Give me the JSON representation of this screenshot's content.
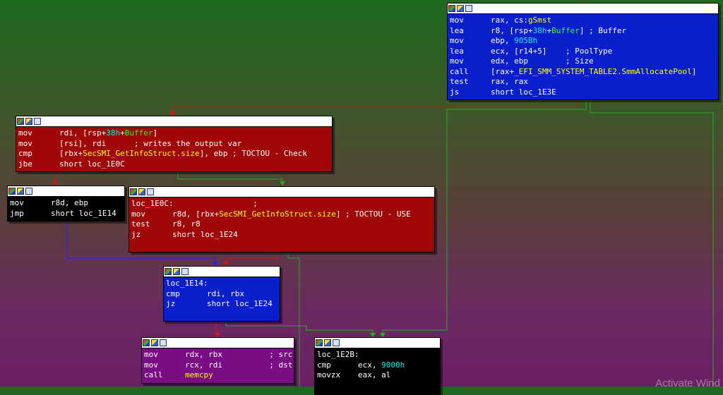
{
  "colors": {
    "blue_block": "#0a1fcc",
    "red_block": "#a00808",
    "black_block": "#000000",
    "purple_block": "#7a0c84",
    "edge_red": "#e01010",
    "edge_green": "#20b020",
    "edge_blue": "#2020ff"
  },
  "icons": [
    "graph-icon",
    "edit-icon",
    "window-icon"
  ],
  "blocks": [
    {
      "id": "block-smmalloc",
      "lines": [
        {
          "op": "mov",
          "args": [
            {
              "t": "rax, cs:"
            },
            {
              "t": "gSmst",
              "c": "y"
            }
          ]
        },
        {
          "op": "lea",
          "args": [
            {
              "t": "r8, [rsp+"
            },
            {
              "t": "38h",
              "c": "c"
            },
            {
              "t": "+"
            },
            {
              "t": "Buffer",
              "c": "g"
            },
            {
              "t": "] ; Buffer"
            }
          ]
        },
        {
          "op": "mov",
          "args": [
            {
              "t": "ebp, "
            },
            {
              "t": "905Bh",
              "c": "c"
            }
          ]
        },
        {
          "op": "lea",
          "args": [
            {
              "t": "ecx, [r14+5]    ; PoolType"
            }
          ]
        },
        {
          "op": "mov",
          "args": [
            {
              "t": "edx, ebp        ; Size"
            }
          ]
        },
        {
          "op": "call",
          "args": [
            {
              "t": "[rax+"
            },
            {
              "t": "_EFI_SMM_SYSTEM_TABLE2.SmmAllocatePool",
              "c": "y"
            },
            {
              "t": "]"
            }
          ]
        },
        {
          "op": "test",
          "args": [
            {
              "t": "rax, rax"
            }
          ]
        },
        {
          "op": "js",
          "args": [
            {
              "t": "short loc_1E3E"
            }
          ]
        }
      ]
    },
    {
      "id": "block-toctou-check",
      "lines": [
        {
          "op": "mov",
          "args": [
            {
              "t": "rdi, [rsp+"
            },
            {
              "t": "38h",
              "c": "c"
            },
            {
              "t": "+"
            },
            {
              "t": "Buffer",
              "c": "g"
            },
            {
              "t": "]"
            }
          ]
        },
        {
          "op": "mov",
          "args": [
            {
              "t": "[rsi], rdi      ; writes the output var"
            }
          ]
        },
        {
          "op": "cmp",
          "args": [
            {
              "t": "[rbx+"
            },
            {
              "t": "SecSMI_GetInfoStruct.size",
              "c": "y"
            },
            {
              "t": "], ebp ; TOCTOU - Check"
            }
          ]
        },
        {
          "op": "jbe",
          "args": [
            {
              "t": "short loc_1E0C"
            }
          ]
        }
      ]
    },
    {
      "id": "block-small-mov",
      "lines": [
        {
          "op": "mov",
          "args": [
            {
              "t": "r8d, ebp"
            }
          ]
        },
        {
          "op": "jmp",
          "args": [
            {
              "t": "short loc_1E14"
            }
          ]
        }
      ]
    },
    {
      "id": "block-toctou-use",
      "lines": [
        {
          "op": "",
          "args": [
            {
              "t": ""
            }
          ]
        },
        {
          "op": "loc_1E0C:",
          "args": [
            {
              "t": "                 ;"
            }
          ]
        },
        {
          "op": "mov",
          "args": [
            {
              "t": "r8d, [rbx+"
            },
            {
              "t": "SecSMI_GetInfoStruct.size",
              "c": "y"
            },
            {
              "t": "] ; TOCTOU - USE"
            }
          ]
        },
        {
          "op": "test",
          "args": [
            {
              "t": "r8, r8"
            }
          ]
        },
        {
          "op": "jz",
          "args": [
            {
              "t": "short loc_1E24"
            }
          ]
        }
      ]
    },
    {
      "id": "block-loc-1e14",
      "lines": [
        {
          "op": "",
          "args": [
            {
              "t": ""
            }
          ]
        },
        {
          "op": "loc_1E14:",
          "args": [
            {
              "t": ""
            }
          ]
        },
        {
          "op": "cmp",
          "args": [
            {
              "t": "rdi, rbx"
            }
          ]
        },
        {
          "op": "jz",
          "args": [
            {
              "t": "short loc_1E24"
            }
          ]
        }
      ]
    },
    {
      "id": "block-memcpy",
      "lines": [
        {
          "op": "mov",
          "args": [
            {
              "t": "rdx, rbx          ; src"
            }
          ]
        },
        {
          "op": "mov",
          "args": [
            {
              "t": "rcx, rdi          ; dst"
            }
          ]
        },
        {
          "op": "call",
          "args": [
            {
              "t": "memcpy",
              "c": "y"
            }
          ]
        }
      ]
    },
    {
      "id": "block-loc-1e2b",
      "lines": [
        {
          "op": "",
          "args": [
            {
              "t": ""
            }
          ]
        },
        {
          "op": "loc_1E2B:",
          "args": [
            {
              "t": ""
            }
          ]
        },
        {
          "op": "cmp",
          "args": [
            {
              "t": "ecx, "
            },
            {
              "t": "9000h",
              "c": "c"
            }
          ]
        },
        {
          "op": "movzx",
          "args": [
            {
              "t": "eax, al"
            }
          ]
        }
      ]
    }
  ],
  "watermark": "Activate Wind"
}
